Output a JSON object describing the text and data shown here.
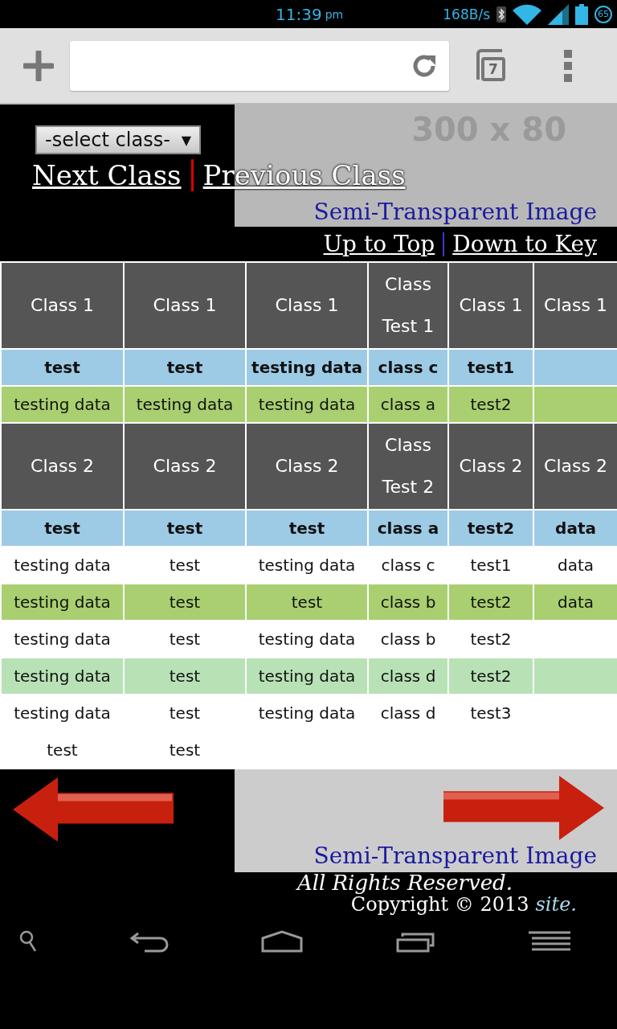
{
  "status_bar": {
    "time": "11:39",
    "ampm": "pm",
    "speed": "168B/s",
    "battery_badge": "65"
  },
  "browser": {
    "tab_count": "7"
  },
  "header": {
    "select": "-select class-",
    "select_arrow": "▼",
    "links": [
      {
        "label": "Next Class"
      },
      {
        "label": "Previous Class"
      }
    ],
    "image": {
      "size_text": "300 x 80",
      "caption": "Semi-Transparent Image"
    },
    "nav_links": [
      {
        "label": "Up to Top"
      },
      {
        "label": "Down to Key"
      }
    ]
  },
  "table": {
    "rows": [
      {
        "kind": "header",
        "color": "#555555",
        "cells": [
          "Class 1",
          "Class 1",
          "Class 1",
          "Class Test 1",
          "Class 1",
          "Class 1"
        ]
      },
      {
        "kind": "key",
        "color": "#9dcbe6",
        "cells": [
          "test",
          "test",
          "testing data",
          "class c",
          "test1",
          null
        ]
      },
      {
        "kind": "data",
        "color": "#a9cf70",
        "cells": [
          "testing data",
          "testing data",
          "testing data",
          "class a",
          "test2",
          null
        ]
      },
      {
        "kind": "header",
        "color": "#555555",
        "cells": [
          "Class 2",
          "Class 2",
          "Class 2",
          "Class Test 2",
          "Class 2",
          "Class 2"
        ]
      },
      {
        "kind": "key",
        "color": "#9dcbe6",
        "cells": [
          "test",
          "test",
          "test",
          "class a",
          "test2",
          "data"
        ]
      },
      {
        "kind": "data",
        "color": "#ffffff",
        "cells": [
          "testing data",
          "test",
          "testing data",
          "class c",
          "test1",
          "data"
        ]
      },
      {
        "kind": "data",
        "color": "#a9cf70",
        "cells": [
          "testing data",
          "test",
          "test",
          "class b",
          "test2",
          "data"
        ]
      },
      {
        "kind": "data",
        "color": "#ffffff",
        "cells": [
          "testing data",
          "test",
          "testing data",
          "class b",
          "test2",
          null
        ]
      },
      {
        "kind": "data",
        "color": "#b8e2b6",
        "cells": [
          "testing data",
          "test",
          "testing data",
          "class d",
          "test2",
          null
        ]
      },
      {
        "kind": "data",
        "color": "#ffffff",
        "cells": [
          "testing data",
          "test",
          "testing data",
          "class d",
          "test3",
          null
        ]
      },
      {
        "kind": "data",
        "color": "#ffffff",
        "cells": [
          "test",
          "test",
          null,
          null,
          null,
          null
        ]
      }
    ]
  },
  "footer": {
    "image_caption": "Semi-Transparent Image",
    "rights": "All Rights Reserved.",
    "copyright": "Copyright © 2013",
    "site_link": "site."
  }
}
